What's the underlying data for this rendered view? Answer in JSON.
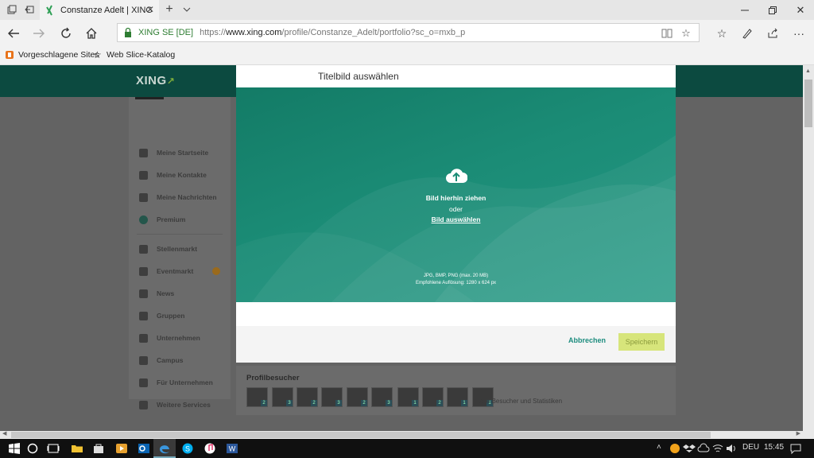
{
  "browser": {
    "tab_title": "Constanze Adelt | XING",
    "address_site": "XING SE [DE]",
    "address_url_prefix": "https://",
    "address_url_domain": "www.xing.com",
    "address_url_path": "/profile/Constanze_Adelt/portfolio?sc_o=mxb_p",
    "favorites": [
      "Vorgeschlagene Sites",
      "Web Slice-Katalog"
    ]
  },
  "page": {
    "logo": "XING",
    "sidebar": [
      {
        "label": "Meine Startseite"
      },
      {
        "label": "Meine Kontakte"
      },
      {
        "label": "Meine Nachrichten"
      },
      {
        "label": "Premium"
      },
      {
        "label": "Stellenmarkt"
      },
      {
        "label": "Eventmarkt"
      },
      {
        "label": "News"
      },
      {
        "label": "Gruppen"
      },
      {
        "label": "Unternehmen"
      },
      {
        "label": "Campus"
      },
      {
        "label": "Für Unternehmen"
      },
      {
        "label": "Weitere Services"
      }
    ],
    "visitors_title": "Profilbesucher",
    "visitors_counts": [
      "2",
      "3",
      "2",
      "3",
      "2",
      "3",
      "1",
      "2",
      "1",
      "1"
    ],
    "visitors_link": "Alle Besucher und Statistiken"
  },
  "modal": {
    "title": "Titelbild auswählen",
    "drop_line1": "Bild hierhin ziehen",
    "drop_line2": "oder",
    "drop_link": "Bild auswählen",
    "formats": "JPG, BMP, PNG (max. 20 MB)",
    "resolution": "Empfohlene Auflösung: 1280 x 624 px",
    "cancel_label": "Abbrechen",
    "save_label": "Speichern"
  },
  "taskbar": {
    "language": "DEU",
    "time": "15:45"
  },
  "colors": {
    "accent": "#1c8c7e",
    "dropzone": "#1b8c76",
    "save_disabled": "#d7e57b",
    "xing_header": "#0c4a40"
  }
}
